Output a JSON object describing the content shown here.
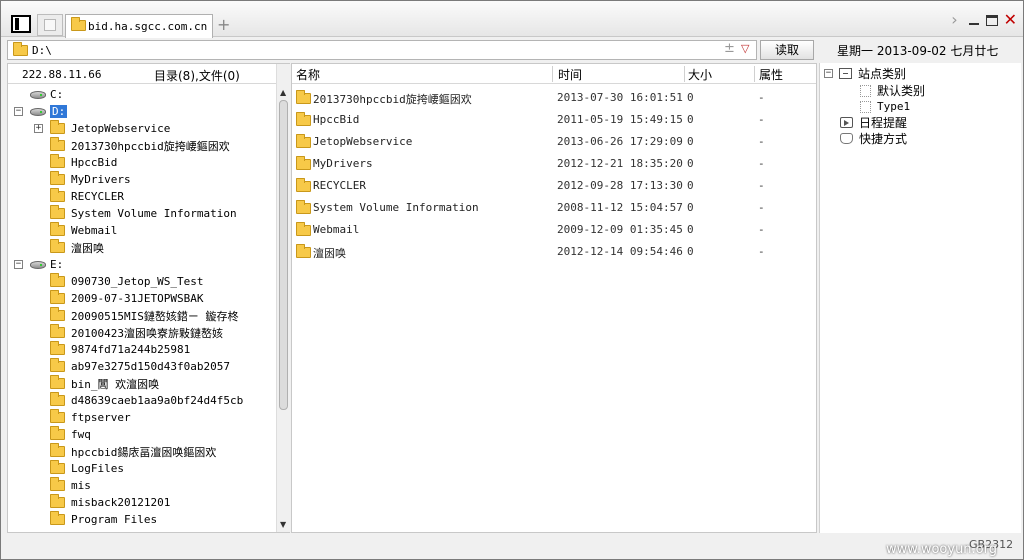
{
  "tab": {
    "title": "bid.ha.sgcc.com.cn"
  },
  "address": {
    "path": "D:\\"
  },
  "toolbar": {
    "read_label": "读取",
    "pin_glyph": "±"
  },
  "date_info": "星期一  2013-09-02  七月廿七",
  "left_panel": {
    "ip": "222.88.11.66",
    "count": "目录(8),文件(0)",
    "tree": [
      {
        "label": "C:",
        "type": "drive"
      },
      {
        "label": "D:",
        "type": "drive",
        "selected": true
      },
      {
        "label": "JetopWebservice",
        "type": "folder"
      },
      {
        "label": "2013730hpccbid旋挎崾鏂囦欢",
        "type": "folder"
      },
      {
        "label": "HpccBid",
        "type": "folder"
      },
      {
        "label": "MyDrivers",
        "type": "folder"
      },
      {
        "label": "RECYCLER",
        "type": "folder"
      },
      {
        "label": "System Volume Information",
        "type": "folder"
      },
      {
        "label": "Webmail",
        "type": "folder"
      },
      {
        "label": "澶囦唤",
        "type": "folder"
      },
      {
        "label": "E:",
        "type": "drive"
      },
      {
        "label": "090730_Jetop_WS_Test",
        "type": "folder"
      },
      {
        "label": "2009-07-31JETOPWSBAK",
        "type": "folder"
      },
      {
        "label": "20090515MIS鏈嶅姟鍣ㄧ   鏇存柊",
        "type": "folder"
      },
      {
        "label": "20100423澶囦唤寮旂敤鏈嶅姟",
        "type": "folder"
      },
      {
        "label": "9874fd71a244b25981",
        "type": "folder"
      },
      {
        "label": "ab97e3275d150d43f0ab2057",
        "type": "folder"
      },
      {
        "label": "bin_閶  欢澶囦唤",
        "type": "folder"
      },
      {
        "label": "d48639caeb1aa9a0bf24d4f5cb",
        "type": "folder"
      },
      {
        "label": "ftpserver",
        "type": "folder"
      },
      {
        "label": "fwq",
        "type": "folder"
      },
      {
        "label": "hpccbid鍚庡畐澶囦唤鏂囦欢",
        "type": "folder"
      },
      {
        "label": "LogFiles",
        "type": "folder"
      },
      {
        "label": "mis",
        "type": "folder"
      },
      {
        "label": "misback20121201",
        "type": "folder"
      },
      {
        "label": "Program Files",
        "type": "folder"
      }
    ]
  },
  "file_list": {
    "columns": [
      "名称",
      "时间",
      "大小",
      "属性"
    ],
    "rows": [
      {
        "name": "2013730hpccbid旋挎崾鏂囦欢",
        "time": "2013-07-30 16:01:51",
        "size": "0",
        "attr": "-"
      },
      {
        "name": "HpccBid",
        "time": "2011-05-19 15:49:15",
        "size": "0",
        "attr": "-"
      },
      {
        "name": "JetopWebservice",
        "time": "2013-06-26 17:29:09",
        "size": "0",
        "attr": "-"
      },
      {
        "name": "MyDrivers",
        "time": "2012-12-21 18:35:20",
        "size": "0",
        "attr": "-"
      },
      {
        "name": "RECYCLER",
        "time": "2012-09-28 17:13:30",
        "size": "0",
        "attr": "-"
      },
      {
        "name": "System Volume Information",
        "time": "2008-11-12 15:04:57",
        "size": "0",
        "attr": "-"
      },
      {
        "name": "Webmail",
        "time": "2009-12-09 01:35:45",
        "size": "0",
        "attr": "-"
      },
      {
        "name": "澶囦唤",
        "time": "2012-12-14 09:54:46",
        "size": "0",
        "attr": "-"
      }
    ]
  },
  "right_panel": {
    "site_category": "站点类别",
    "default_category": "默认类别",
    "type1": "Type1",
    "schedule": "日程提醒",
    "shortcut": "快捷方式"
  },
  "status": {
    "encoding": "GB2312"
  },
  "watermark": "www.wooyun.org"
}
